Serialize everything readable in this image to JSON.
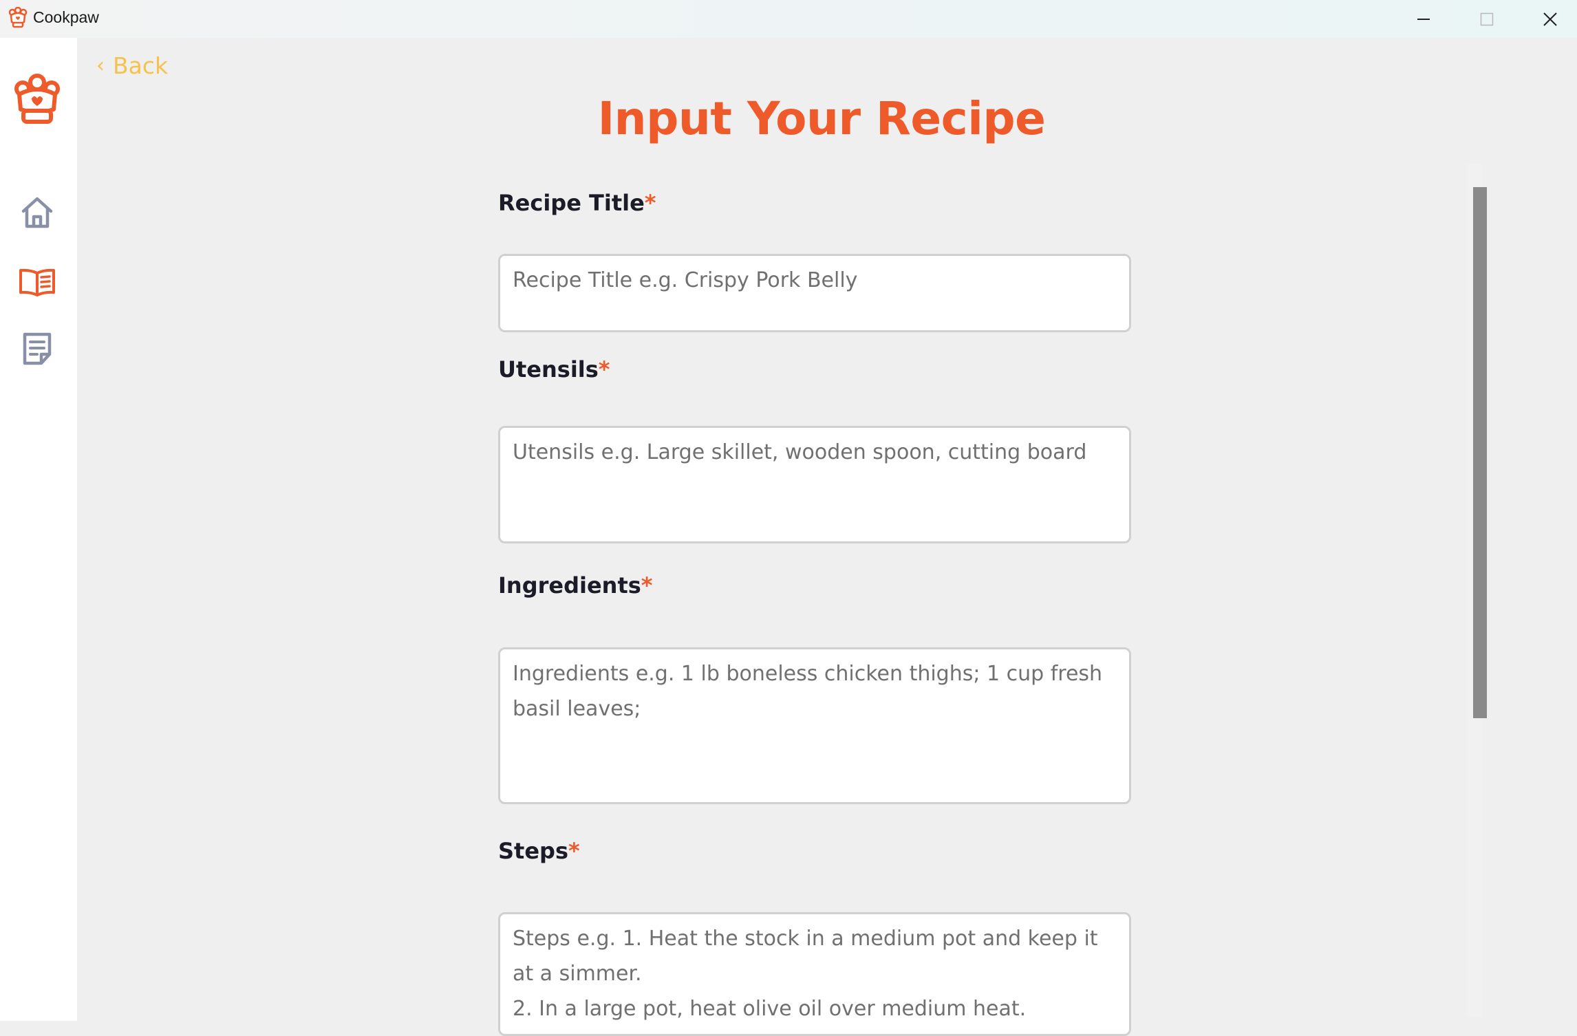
{
  "window": {
    "title": "Cookpaw",
    "icon": "cookpaw-logo-icon",
    "controls": [
      "minimize-icon",
      "maximize-icon",
      "close-icon"
    ]
  },
  "sidebar": {
    "logo": "chef-paw-logo-icon",
    "items": [
      {
        "name": "home",
        "icon": "home-icon",
        "active": false
      },
      {
        "name": "recipe-book",
        "icon": "open-book-icon",
        "active": true
      },
      {
        "name": "notes",
        "icon": "notes-icon",
        "active": false
      }
    ]
  },
  "nav": {
    "back_label": "Back",
    "back_icon": "chevron-left-icon"
  },
  "page": {
    "title": "Input Your Recipe"
  },
  "form": {
    "required_marker": "*",
    "recipe_title": {
      "label": "Recipe Title",
      "placeholder": "Recipe Title e.g. Crispy Pork Belly",
      "value": ""
    },
    "utensils": {
      "label": "Utensils",
      "placeholder": "Utensils e.g. Large skillet, wooden spoon, cutting board",
      "value": ""
    },
    "ingredients": {
      "label": "Ingredients",
      "placeholder": "Ingredients e.g. 1 lb boneless chicken thighs; 1 cup fresh basil leaves;",
      "value": ""
    },
    "steps": {
      "label": "Steps",
      "placeholder": "Steps e.g. 1. Heat the stock in a medium pot and keep it at a simmer.\n2. In a large pot, heat olive oil over medium heat.",
      "value": ""
    }
  },
  "colors": {
    "accent": "#ef5a2a",
    "back_link": "#f7c24b",
    "icon_inactive": "#8a8fa8",
    "background": "#efefef"
  }
}
